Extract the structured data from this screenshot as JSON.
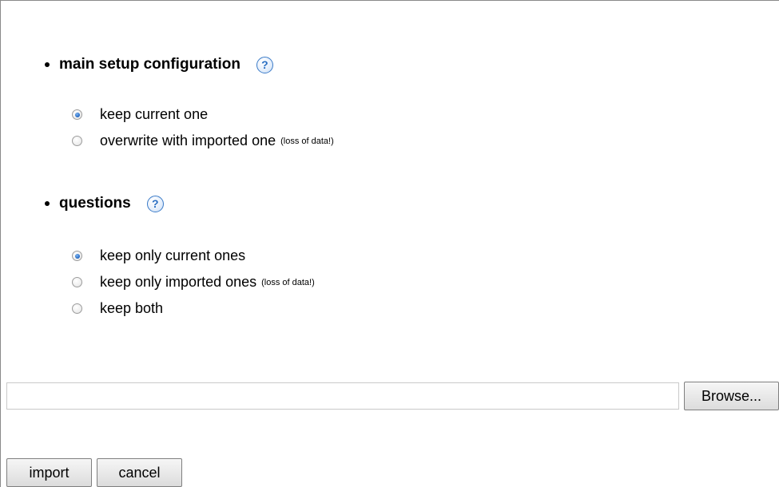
{
  "sections": {
    "main_setup": {
      "title": "main setup configuration",
      "help_icon": "?",
      "options": [
        {
          "label": "keep current one",
          "note": "",
          "checked": true
        },
        {
          "label": "overwrite with imported one",
          "note": "(loss of data!)",
          "checked": false
        }
      ]
    },
    "questions": {
      "title": "questions",
      "help_icon": "?",
      "options": [
        {
          "label": "keep only current ones",
          "note": "",
          "checked": true
        },
        {
          "label": "keep only imported ones",
          "note": "(loss of data!)",
          "checked": false
        },
        {
          "label": "keep both",
          "note": "",
          "checked": false
        }
      ]
    }
  },
  "file": {
    "value": "",
    "browse_label": "Browse..."
  },
  "actions": {
    "import_label": "import",
    "cancel_label": "cancel"
  }
}
